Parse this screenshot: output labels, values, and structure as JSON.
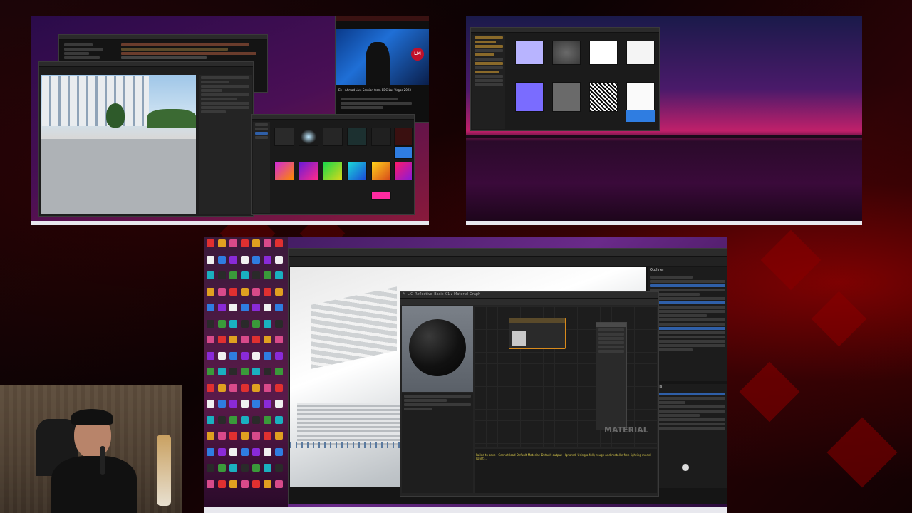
{
  "monitor1": {
    "code_window": {
      "title": ""
    },
    "viewport_window": {
      "title": ""
    },
    "youtube": {
      "video_title": "Ek - Ahmad Live Session from EDC Las Vegas 2023",
      "channel": "",
      "badge": "LM"
    },
    "content_browser": {
      "title": ""
    }
  },
  "monitor2": {
    "texture_browser": {
      "title": ""
    }
  },
  "monitor3": {
    "material_editor": {
      "tab_title": "M_LIC_Reflective_Basic_01 ▸ Material Graph",
      "watermark": "MATERIAL",
      "log_text": "Failed to save : Cannot load Default Material: Default output - Ignored: Using a fully rough and metallic-free lighting model (Unlit)..."
    },
    "outliner": {
      "title": "Outliner"
    },
    "details": {
      "title": "Details"
    }
  },
  "colors": {
    "accent_blue": "#2f7de1",
    "accent_red": "#b00010",
    "node_header_orange": "#d88a1c",
    "taskbar": "#e8e8ee"
  }
}
